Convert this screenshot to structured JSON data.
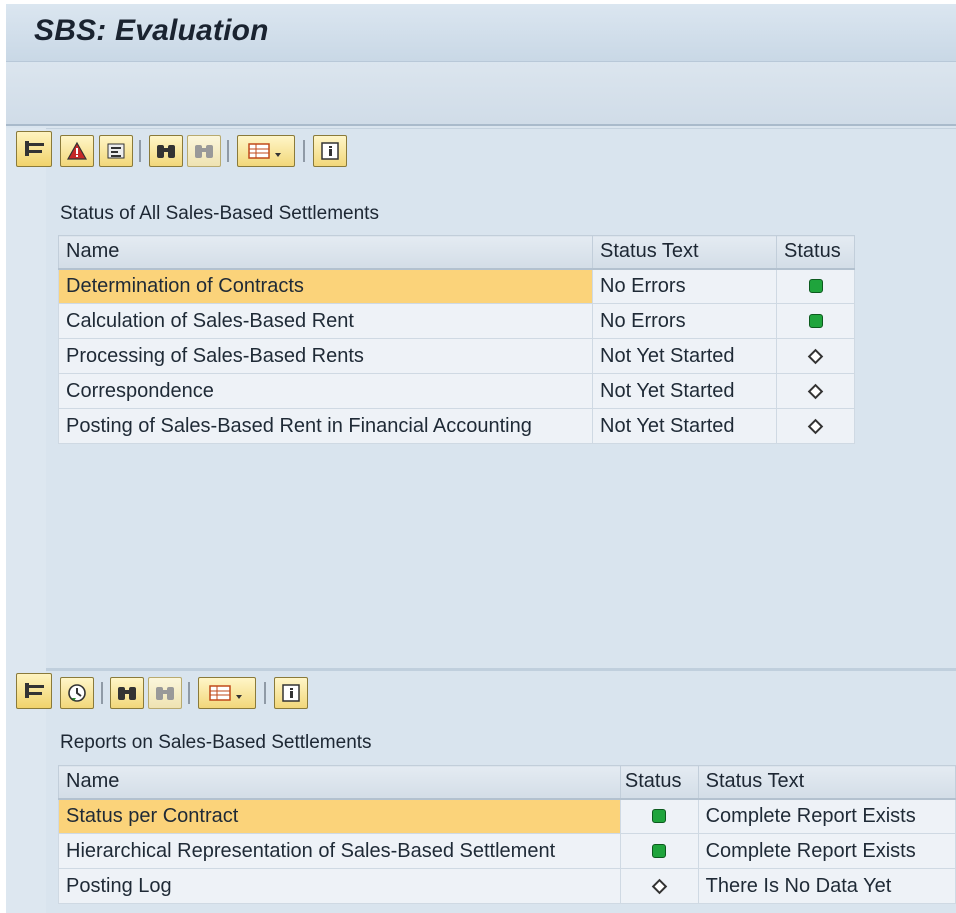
{
  "window": {
    "title": "SBS: Evaluation"
  },
  "panel1": {
    "title": "Status of All Sales-Based Settlements",
    "columns": [
      "Name",
      "Status Text",
      "Status"
    ],
    "rows": [
      {
        "name": "Determination of Contracts",
        "status_text": "No Errors",
        "status": "green"
      },
      {
        "name": "Calculation of Sales-Based Rent",
        "status_text": "No Errors",
        "status": "green"
      },
      {
        "name": "Processing of Sales-Based Rents",
        "status_text": "Not Yet Started",
        "status": "diamond"
      },
      {
        "name": "Correspondence",
        "status_text": "Not Yet Started",
        "status": "diamond"
      },
      {
        "name": "Posting of Sales-Based Rent in Financial Accounting",
        "status_text": "Not Yet Started",
        "status": "diamond"
      }
    ]
  },
  "panel2": {
    "title": "Reports on Sales-Based Settlements",
    "columns": [
      "Name",
      "Status",
      "Status Text"
    ],
    "rows": [
      {
        "name": "Status per Contract",
        "status": "green",
        "status_text": "Complete Report Exists"
      },
      {
        "name": "Hierarchical Representation of Sales-Based Settlement",
        "status": "green",
        "status_text": "Complete Report Exists"
      },
      {
        "name": "Posting Log",
        "status": "diamond",
        "status_text": "There Is No Data Yet"
      }
    ]
  },
  "icons": {
    "panel1_toolbar": [
      "expand-icon",
      "alert-icon",
      "settings-icon",
      "find-icon",
      "find-next-icon",
      "layout-icon",
      "info-icon"
    ],
    "panel2_toolbar": [
      "expand-icon",
      "execute-icon",
      "find-icon",
      "find-next-icon",
      "layout-icon",
      "info-icon"
    ]
  },
  "colors": {
    "selected_row": "#fbd37a",
    "status_green": "#1fa43c",
    "background": "#d9e4ee"
  }
}
